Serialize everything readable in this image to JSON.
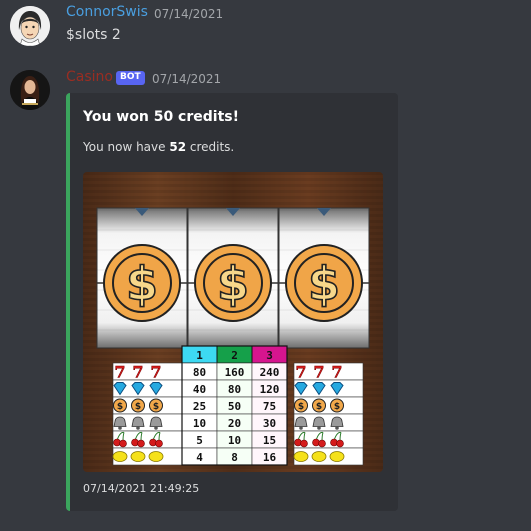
{
  "messages": [
    {
      "username": "ConnorSwis",
      "username_color": "#4a9fe0",
      "timestamp": "07/14/2021",
      "content": "$slots 2"
    },
    {
      "username": "Casino",
      "username_color": "#992d22",
      "bot_tag": "BOT",
      "timestamp": "07/14/2021",
      "embed": {
        "accent_color": "#3ba55d",
        "title": "You won 50 credits!",
        "description_prefix": "You now have ",
        "description_bold": "52",
        "description_suffix": " credits.",
        "footer": "07/14/2021 21:49:25"
      }
    }
  ],
  "slot_machine": {
    "reels": [
      "dollar-coin",
      "dollar-coin",
      "dollar-coin"
    ],
    "payout_headers": [
      "1",
      "2",
      "3"
    ],
    "payout_rows": [
      {
        "symbol": "seven",
        "values": [
          "80",
          "160",
          "240"
        ]
      },
      {
        "symbol": "diamond",
        "values": [
          "40",
          "80",
          "120"
        ]
      },
      {
        "symbol": "coin",
        "values": [
          "25",
          "50",
          "75"
        ]
      },
      {
        "symbol": "bell",
        "values": [
          "10",
          "20",
          "30"
        ]
      },
      {
        "symbol": "cherry",
        "values": [
          "5",
          "10",
          "15"
        ]
      },
      {
        "symbol": "lemon",
        "values": [
          "4",
          "8",
          "16"
        ]
      }
    ]
  }
}
